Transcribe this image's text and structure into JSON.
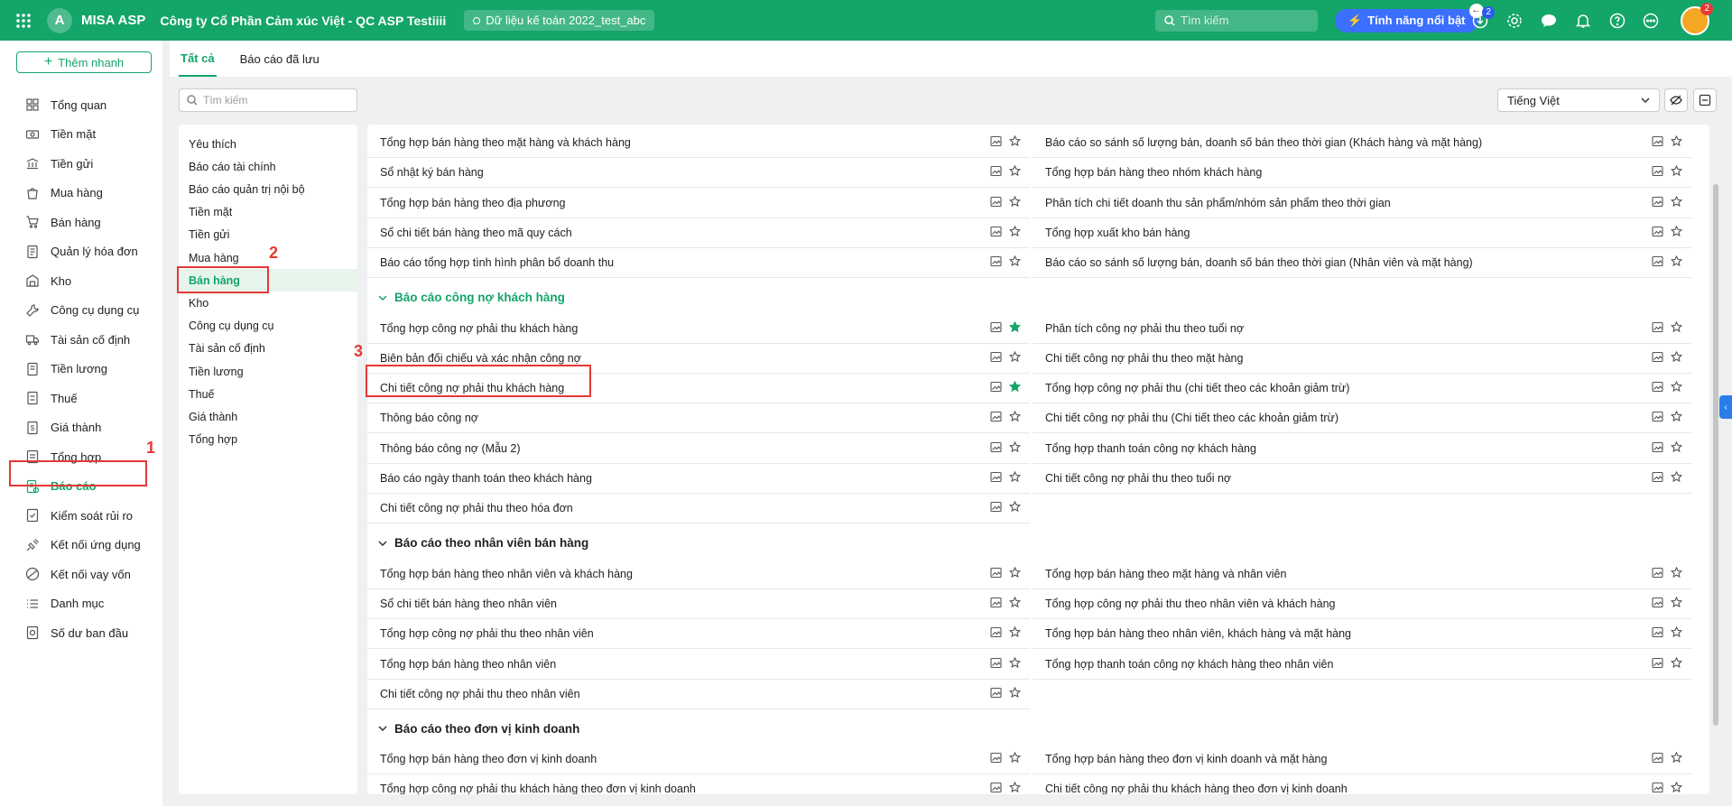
{
  "header": {
    "app_name": "MISA ASP",
    "company": "Công ty Cổ Phần Cảm xúc Việt - QC ASP Testiiii",
    "database": "Dữ liệu kế toán 2022_test_abc",
    "search_placeholder": "Tìm kiếm",
    "feature_label": "Tính năng nổi bật",
    "download_badge": "2",
    "avatar_badge": "2"
  },
  "sidebar": {
    "quick_add": "Thêm nhanh",
    "items": [
      {
        "label": "Tổng quan",
        "icon": "dashboard-icon"
      },
      {
        "label": "Tiền mặt",
        "icon": "cash-icon"
      },
      {
        "label": "Tiền gửi",
        "icon": "bank-icon"
      },
      {
        "label": "Mua hàng",
        "icon": "shopping-bag-icon"
      },
      {
        "label": "Bán hàng",
        "icon": "cart-icon"
      },
      {
        "label": "Quản lý hóa đơn",
        "icon": "invoice-icon"
      },
      {
        "label": "Kho",
        "icon": "warehouse-icon"
      },
      {
        "label": "Công cụ dụng cụ",
        "icon": "tools-icon"
      },
      {
        "label": "Tài sản cố định",
        "icon": "truck-icon"
      },
      {
        "label": "Tiền lương",
        "icon": "salary-icon"
      },
      {
        "label": "Thuế",
        "icon": "tax-icon"
      },
      {
        "label": "Giá thành",
        "icon": "price-icon"
      },
      {
        "label": "Tổng hợp",
        "icon": "summary-icon"
      },
      {
        "label": "Báo cáo",
        "icon": "report-icon"
      },
      {
        "label": "Kiểm soát rủi ro",
        "icon": "risk-icon"
      },
      {
        "label": "Kết nối ứng dụng",
        "icon": "plug-icon"
      },
      {
        "label": "Kết nối vay vốn",
        "icon": "loan-icon"
      },
      {
        "label": "Danh mục",
        "icon": "list-icon"
      },
      {
        "label": "Số dư ban đầu",
        "icon": "balance-icon"
      }
    ],
    "active_index": 13
  },
  "tabs": [
    "Tất cả",
    "Báo cáo đã lưu"
  ],
  "filter": {
    "search_placeholder": "Tìm kiếm",
    "language": "Tiếng Việt"
  },
  "categories": [
    "Yêu thích",
    "Báo cáo tài chính",
    "Báo cáo quản trị nội bộ",
    "Tiền mặt",
    "Tiền gửi",
    "Mua hàng",
    "Bán hàng",
    "Kho",
    "Công cụ dụng cụ",
    "Tài sản cố định",
    "Tiền lương",
    "Thuế",
    "Giá thành",
    "Tổng hợp"
  ],
  "active_category_index": 6,
  "annotations": {
    "n1": "1",
    "n2": "2",
    "n3": "3"
  },
  "top_rows": [
    {
      "left": "Tổng hợp bán hàng theo mặt hàng và khách hàng",
      "right": "Báo cáo so sánh số lượng bán, doanh số bán theo thời gian (Khách hàng và mặt hàng)"
    },
    {
      "left": "Sổ nhật ký bán hàng",
      "right": "Tổng hợp bán hàng theo nhóm khách hàng"
    },
    {
      "left": "Tổng hợp bán hàng theo địa phương",
      "right": "Phân tích chi tiết doanh thu sản phẩm/nhóm sản phẩm theo thời gian"
    },
    {
      "left": "Sổ chi tiết bán hàng theo mã quy cách",
      "right": "Tổng hợp xuất kho bán hàng"
    },
    {
      "left": "Báo cáo tổng hợp tình hình phân bổ doanh thu",
      "right": "Báo cáo so sánh số lượng bán, doanh số bán theo thời gian (Nhân viên và mặt hàng)"
    }
  ],
  "sections": [
    {
      "title": "Báo cáo công nợ khách hàng",
      "rows": [
        {
          "left": "Tổng hợp công nợ phải thu khách hàng",
          "left_fav": true,
          "right": "Phân tích công nợ phải thu theo tuổi nợ"
        },
        {
          "left": "Biên bản đối chiếu và xác nhận công nợ",
          "right": "Chi tiết công nợ phải thu theo mặt hàng"
        },
        {
          "left": "Chi tiết công nợ phải thu khách hàng",
          "left_fav": true,
          "right": "Tổng hợp công nợ phải thu (chi tiết theo các khoản giảm trừ)"
        },
        {
          "left": "Thông báo công nợ",
          "right": "Chi tiết công nợ phải thu (Chi tiết theo các khoản giảm trừ)"
        },
        {
          "left": "Thông báo công nợ (Mẫu 2)",
          "right": "Tổng hợp thanh toán công nợ khách hàng"
        },
        {
          "left": "Báo cáo ngày thanh toán theo khách hàng",
          "right": "Chi tiết công nợ phải thu theo tuổi nợ"
        },
        {
          "left": "Chi tiết công nợ phải thu theo hóa đơn",
          "right": ""
        }
      ]
    },
    {
      "title": "Báo cáo theo nhân viên bán hàng",
      "rows": [
        {
          "left": "Tổng hợp bán hàng theo nhân viên và khách hàng",
          "right": "Tổng hợp bán hàng theo mặt hàng và nhân viên"
        },
        {
          "left": "Sổ chi tiết bán hàng theo nhân viên",
          "right": "Tổng hợp công nợ phải thu theo nhân viên và khách hàng"
        },
        {
          "left": "Tổng hợp công nợ phải thu theo nhân viên",
          "right": "Tổng hợp bán hàng theo nhân viên, khách hàng và mặt hàng"
        },
        {
          "left": "Tổng hợp bán hàng theo nhân viên",
          "right": "Tổng hợp thanh toán công nợ khách hàng theo nhân viên"
        },
        {
          "left": "Chi tiết công nợ phải thu theo nhân viên",
          "right": ""
        }
      ]
    },
    {
      "title": "Báo cáo theo đơn vị kinh doanh",
      "rows": [
        {
          "left": "Tổng hợp bán hàng theo đơn vị kinh doanh",
          "right": "Tổng hợp bán hàng theo đơn vị kinh doanh và mặt hàng"
        },
        {
          "left": "Tổng hợp công nợ phải thu khách hàng theo đơn vị kinh doanh",
          "right": "Chi tiết công nợ phải thu khách hàng theo đơn vị kinh doanh"
        }
      ]
    }
  ],
  "colors": {
    "brand": "#14a568",
    "annotation": "#e53935",
    "star_filled": "#14a568"
  }
}
